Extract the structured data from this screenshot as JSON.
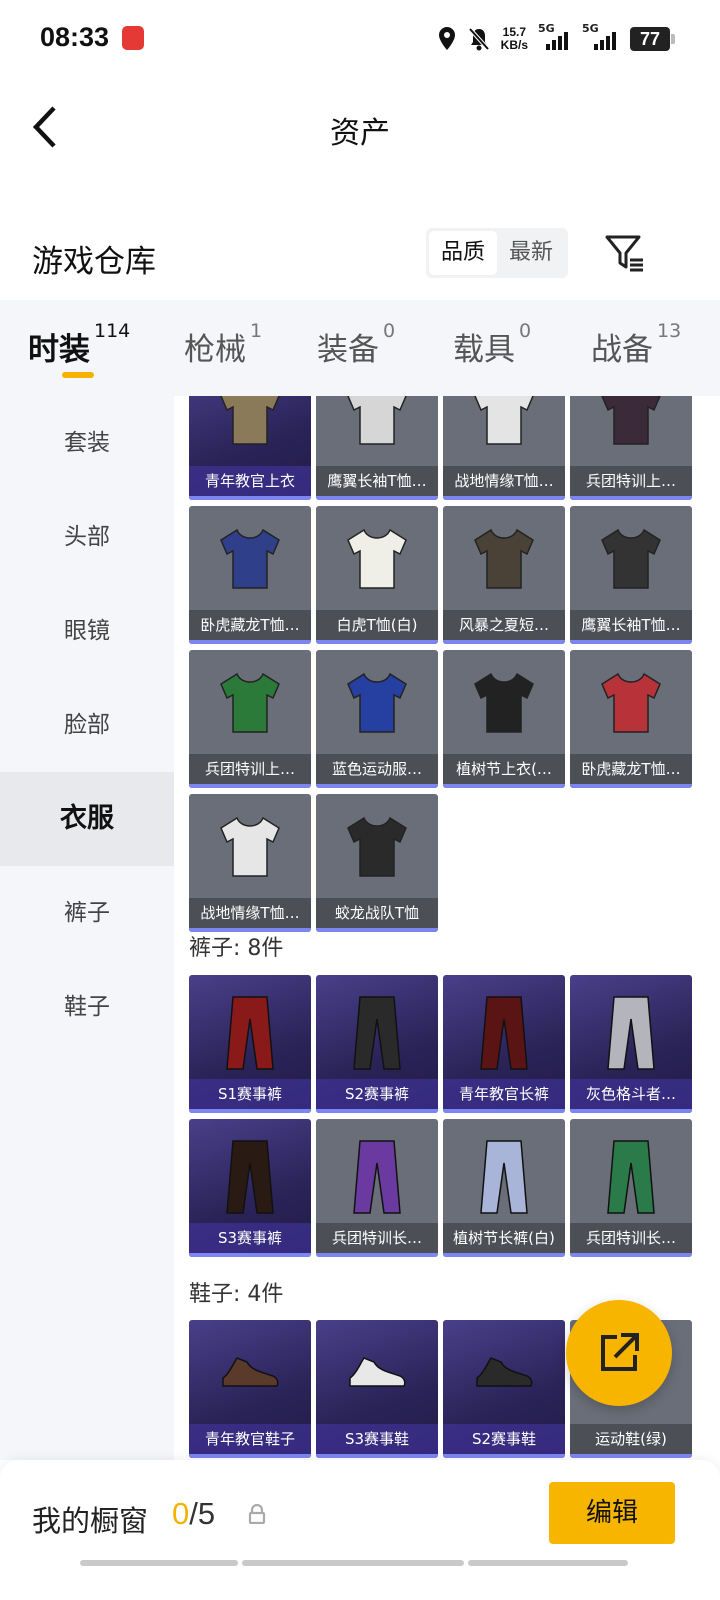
{
  "status_bar": {
    "time": "08:33",
    "net_speed": "15.7",
    "net_unit": "KB/s",
    "signal1": "5G",
    "signal2": "5G",
    "battery": "77"
  },
  "nav": {
    "title": "资产"
  },
  "header": {
    "title": "游戏仓库",
    "sort_options": [
      "品质",
      "最新"
    ],
    "active_sort": "品质"
  },
  "category_tabs": [
    {
      "label": "时装",
      "count": "114"
    },
    {
      "label": "枪械",
      "count": "1"
    },
    {
      "label": "装备",
      "count": "0"
    },
    {
      "label": "载具",
      "count": "0"
    },
    {
      "label": "战备",
      "count": "13"
    }
  ],
  "sidebar": {
    "items": [
      "套装",
      "头部",
      "眼镜",
      "脸部",
      "衣服",
      "裤子",
      "鞋子"
    ],
    "active": "衣服"
  },
  "clothes": {
    "items": [
      "青年教官上衣",
      "鹰翼长袖T恤…",
      "战地情缘T恤…",
      "兵团特训上…",
      "卧虎藏龙T恤…",
      "白虎T恤(白)",
      "风暴之夏短…",
      "鹰翼长袖T恤…",
      "兵团特训上…",
      "蓝色运动服…",
      "植树节上衣(…",
      "卧虎藏龙T恤…",
      "战地情缘T恤…",
      "蛟龙战队T恤"
    ]
  },
  "pants": {
    "title": "裤子: 8件",
    "items": [
      "S1赛事裤",
      "S2赛事裤",
      "青年教官长裤",
      "灰色格斗者…",
      "S3赛事裤",
      "兵团特训长…",
      "植树节长裤(白)",
      "兵团特训长…"
    ]
  },
  "shoes": {
    "title": "鞋子: 4件",
    "items": [
      "青年教官鞋子",
      "S3赛事鞋",
      "S2赛事鞋",
      "运动鞋(绿)"
    ]
  },
  "bottom": {
    "label": "我的橱窗",
    "current": "0",
    "separator": "/",
    "max": "5",
    "edit": "编辑"
  }
}
